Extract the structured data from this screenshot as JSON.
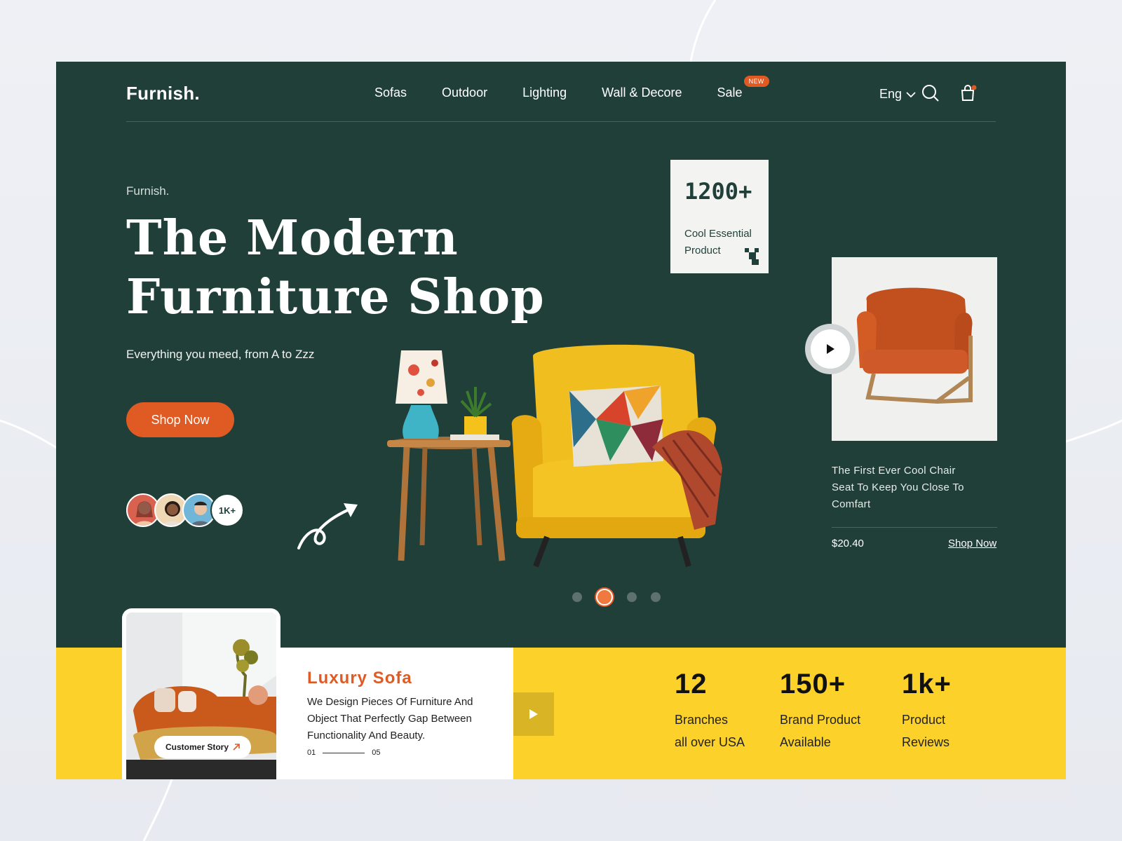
{
  "brand": "Furnish.",
  "nav": {
    "items": [
      "Sofas",
      "Outdoor",
      "Lighting",
      "Wall & Decore",
      "Sale"
    ],
    "sale_badge": "NEW",
    "language": "Eng"
  },
  "hero": {
    "eyebrow": "Furnish.",
    "title_line1": "The Modern",
    "title_line2": "Furniture Shop",
    "subtitle": "Everything you meed, from A to Zzz",
    "cta": "Shop Now",
    "avatars_count": "1K+"
  },
  "stat_card": {
    "number": "1200+",
    "label_line1": "Cool Essential",
    "label_line2": "Product"
  },
  "product": {
    "desc_line1": "The First Ever Cool Chair",
    "desc_line2": "Seat To Keep You Close To",
    "desc_line3": "Comfart",
    "price": "$20.40",
    "shop_link": "Shop Now"
  },
  "carousel": {
    "total": 4,
    "active_index": 2
  },
  "story": {
    "button": "Customer Story"
  },
  "luxury": {
    "title": "Luxury Sofa",
    "line1": "We Design Pieces Of Furniture And",
    "line2": "Object That Perfectly Gap Between",
    "line3": "Functionality And Beauty.",
    "pager_start": "01",
    "pager_end": "05"
  },
  "stats": [
    {
      "value": "12",
      "line1": "Branches",
      "line2": "all over USA"
    },
    {
      "value": "150+",
      "line1": "Brand Product",
      "line2": "Available"
    },
    {
      "value": "1k+",
      "line1": "Product",
      "line2": "Reviews"
    }
  ],
  "colors": {
    "primary_green": "#1f3f38",
    "accent_orange": "#e05a24",
    "accent_yellow": "#fcd22a"
  }
}
